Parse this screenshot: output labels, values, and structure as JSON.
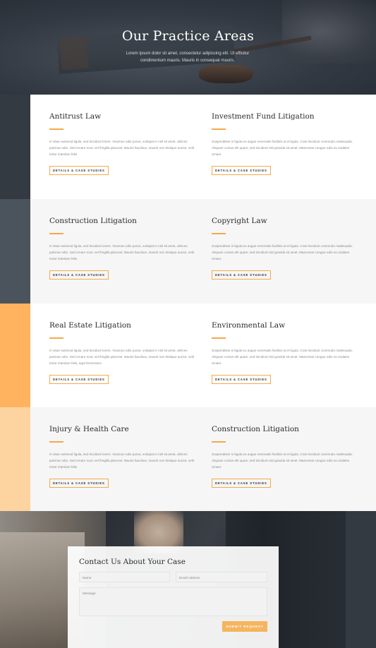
{
  "hero": {
    "title": "Our Practice Areas",
    "subtitle": "Lorem ipsum dolor sit amet, consectetur adipiscing elit. Ut efficitur condimentum mauris. Mauris in consequat mauris."
  },
  "colors": {
    "accent": "#f5a94a",
    "strip_dark": "#343a42",
    "strip_slate": "#4b545d",
    "strip_orange": "#ffb35f",
    "strip_peach": "#fdd49f",
    "row_grey": "#f6f6f6"
  },
  "practice_rows": [
    {
      "left": {
        "title": "Antitrust Law",
        "body": "In vitae euismod ligula, sed tincidunt lorem. Vivamus odio purus, volutpat in nisl sit amet, ultrices pulvinar odio. Sed ornare nunc vel fringilla placerat. Mauris faucibus, mauris non tristique auctor, velit tortor interdum felis",
        "button": "DETAILS & CASE STUDIES"
      },
      "right": {
        "title": "Investment Fund Litigation",
        "body": "Suspendisse in ligula eu augue venenatis facilisis at et ligula. Cras tincidunt commodo malesuada. Aliquam cursus elit quam, sed tincidunt nisl gravida sit amet. Maecenas congue odio eu sodales ornare.",
        "button": "DETAILS & CASE STUDIES"
      }
    },
    {
      "left": {
        "title": "Construction Litigation",
        "body": "In vitae euismod ligula, sed tincidunt lorem. Vivamus odio purus, volutpat in nisl sit amet, ultrices pulvinar odio. Sed ornare nunc vel fringilla placerat. Mauris faucibus, mauris non tristique auctor, velit tortor interdum felis",
        "button": "DETAILS & CASE STUDIES"
      },
      "right": {
        "title": "Copyright Law",
        "body": "Suspendisse in ligula eu augue venenatis facilisis at et ligula. Cras tincidunt commodo malesuada. Aliquam cursus elit quam, sed tincidunt nisl gravida sit amet. Maecenas congue odio eu sodales ornare.",
        "button": "DETAILS & CASE STUDIES"
      }
    },
    {
      "left": {
        "title": "Real Estate Litigation",
        "body": "In vitae euismod ligula, sed tincidunt lorem. Vivamus odio purus, volutpat in nisl sit amet, ultrices pulvinar odio. Sed ornare nunc vel fringilla placerat. Mauris faucibus, mauris non tristique auctor, velit tortor interdum felis, eget fermentum",
        "button": "DETAILS & CASE STUDIES"
      },
      "right": {
        "title": "Environmental Law",
        "body": "Suspendisse in ligula eu augue venenatis facilisis at et ligula. Cras tincidunt commodo malesuada. Aliquam cursus elit quam, sed tincidunt nisl gravida sit amet. Maecenas congue odio eu sodales ornare.",
        "button": "DETAILS & CASE STUDIES"
      }
    },
    {
      "left": {
        "title": "Injury & Health Care",
        "body": "In vitae euismod ligula, sed tincidunt lorem. Vivamus odio purus, volutpat in nisl sit amet, ultrices pulvinar odio. Sed ornare nunc vel fringilla placerat. Mauris faucibus, mauris non tristique auctor, velit tortor interdum felis",
        "button": "DETAILS & CASE STUDIES"
      },
      "right": {
        "title": "Construction Litigation",
        "body": "Suspendisse in ligula eu augue venenatis facilisis at et ligula. Cras tincidunt commodo malesuada. Aliquam cursus elit quam, sed tincidunt nisl gravida sit amet. Maecenas congue odio eu sodales ornare.",
        "button": "DETAILS & CASE STUDIES"
      }
    }
  ],
  "contact": {
    "title": "Contact Us About Your Case",
    "name_placeholder": "Name",
    "email_placeholder": "Email Address",
    "message_placeholder": "Message",
    "submit_label": "SUBMIT REQUEST"
  }
}
